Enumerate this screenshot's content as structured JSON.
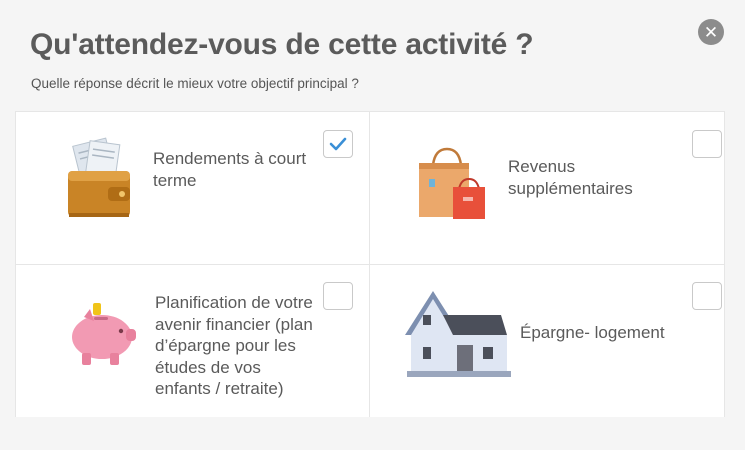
{
  "dialog": {
    "title": "Qu'attendez-vous de cette activité ?",
    "subtitle": "Quelle réponse décrit le mieux votre objectif principal ?",
    "close_symbol": "✕"
  },
  "options": [
    {
      "label": "Rendements à court terme",
      "icon": "wallet-icon",
      "checked": true
    },
    {
      "label": "Revenus supplémentaires",
      "icon": "shopping-bags-icon",
      "checked": false
    },
    {
      "label": "Planification de votre avenir financier (plan d’épargne pour les études de vos enfants / retraite)",
      "icon": "piggy-bank-icon",
      "checked": false
    },
    {
      "label": "Épargne- logement",
      "icon": "house-icon",
      "checked": false
    }
  ],
  "colors": {
    "checkmark": "#3a8fd6",
    "checkbox_border": "#c9c9c9",
    "title": "#5b5b5b"
  }
}
